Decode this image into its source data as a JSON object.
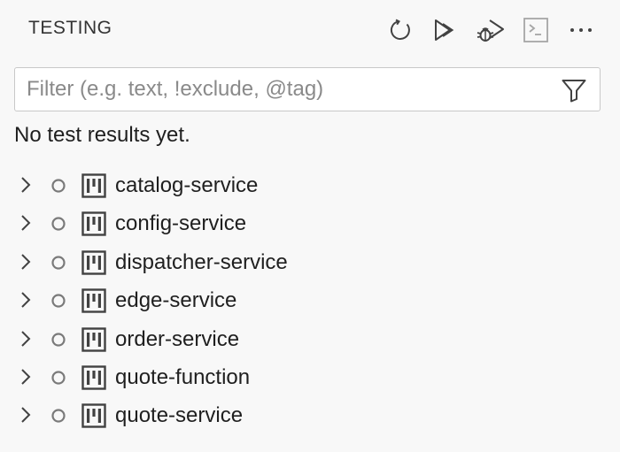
{
  "header": {
    "title": "TESTING",
    "actions": [
      {
        "name": "refresh-tests-button",
        "icon": "refresh-icon"
      },
      {
        "name": "run-all-tests-button",
        "icon": "run-all-icon"
      },
      {
        "name": "debug-all-tests-button",
        "icon": "debug-all-icon"
      },
      {
        "name": "show-output-button",
        "icon": "terminal-icon"
      },
      {
        "name": "more-actions-button",
        "icon": "ellipsis-icon"
      }
    ]
  },
  "filter": {
    "value": "",
    "placeholder": "Filter (e.g. text, !exclude, @tag)",
    "icon": "filter-icon"
  },
  "status": "No test results yet.",
  "tree": {
    "items": [
      {
        "label": "catalog-service"
      },
      {
        "label": "config-service"
      },
      {
        "label": "dispatcher-service"
      },
      {
        "label": "edge-service"
      },
      {
        "label": "order-service"
      },
      {
        "label": "quote-function"
      },
      {
        "label": "quote-service"
      }
    ],
    "row_icons": {
      "expand": "chevron-right-icon",
      "state": "circle-outline-icon",
      "project": "project-icon"
    }
  },
  "colors": {
    "background": "#f8f8f8",
    "text": "#1f1f1f",
    "icon": "#424242",
    "status_circle": "#7a7a7a",
    "disabled_icon": "#a6a6a6",
    "border": "#c8c8c8"
  }
}
